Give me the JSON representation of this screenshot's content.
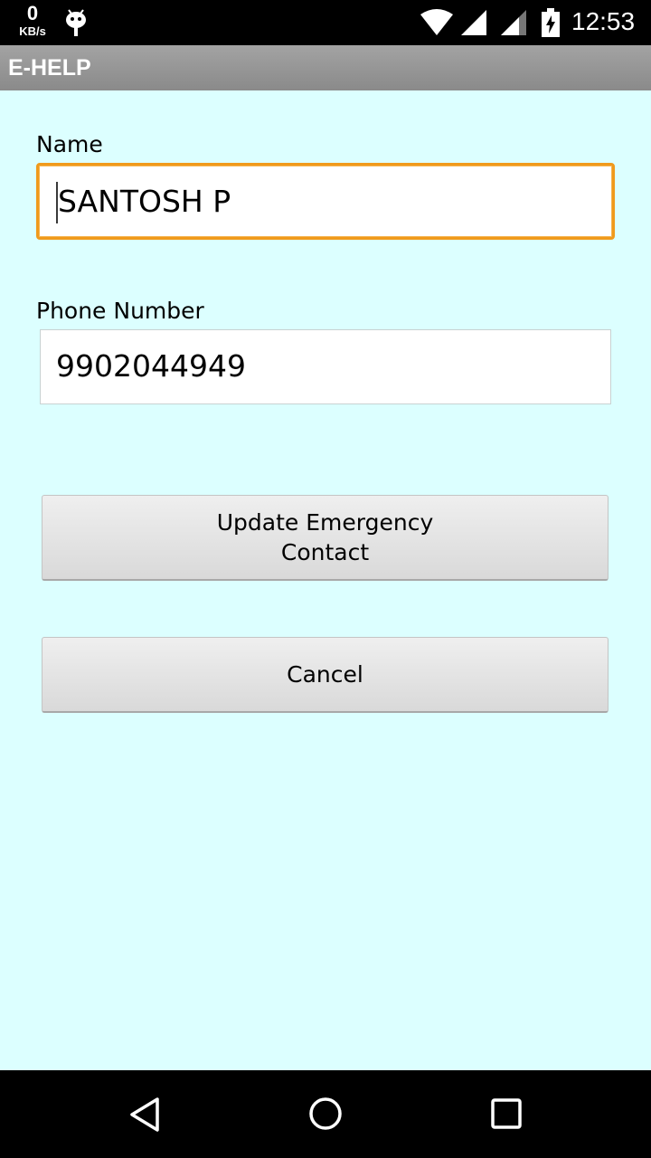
{
  "status_bar": {
    "net_speed_value": "0",
    "net_speed_unit": "KB/s",
    "time": "12:53",
    "icons": [
      "android-icon",
      "wifi-icon",
      "signal-icon",
      "signal-icon",
      "battery-charging-icon"
    ]
  },
  "app": {
    "title": "E-HELP"
  },
  "form": {
    "name_label": "Name",
    "name_value": "SANTOSH P",
    "phone_label": "Phone Number",
    "phone_value": "9902044949",
    "update_button_label": "Update Emergency Contact",
    "cancel_button_label": "Cancel"
  },
  "nav_bar": {
    "icons": [
      "back-icon",
      "home-icon",
      "recents-icon"
    ]
  },
  "colors": {
    "background": "#dcffff",
    "title_bar": "#969696",
    "focus_border": "#f09a1c"
  }
}
